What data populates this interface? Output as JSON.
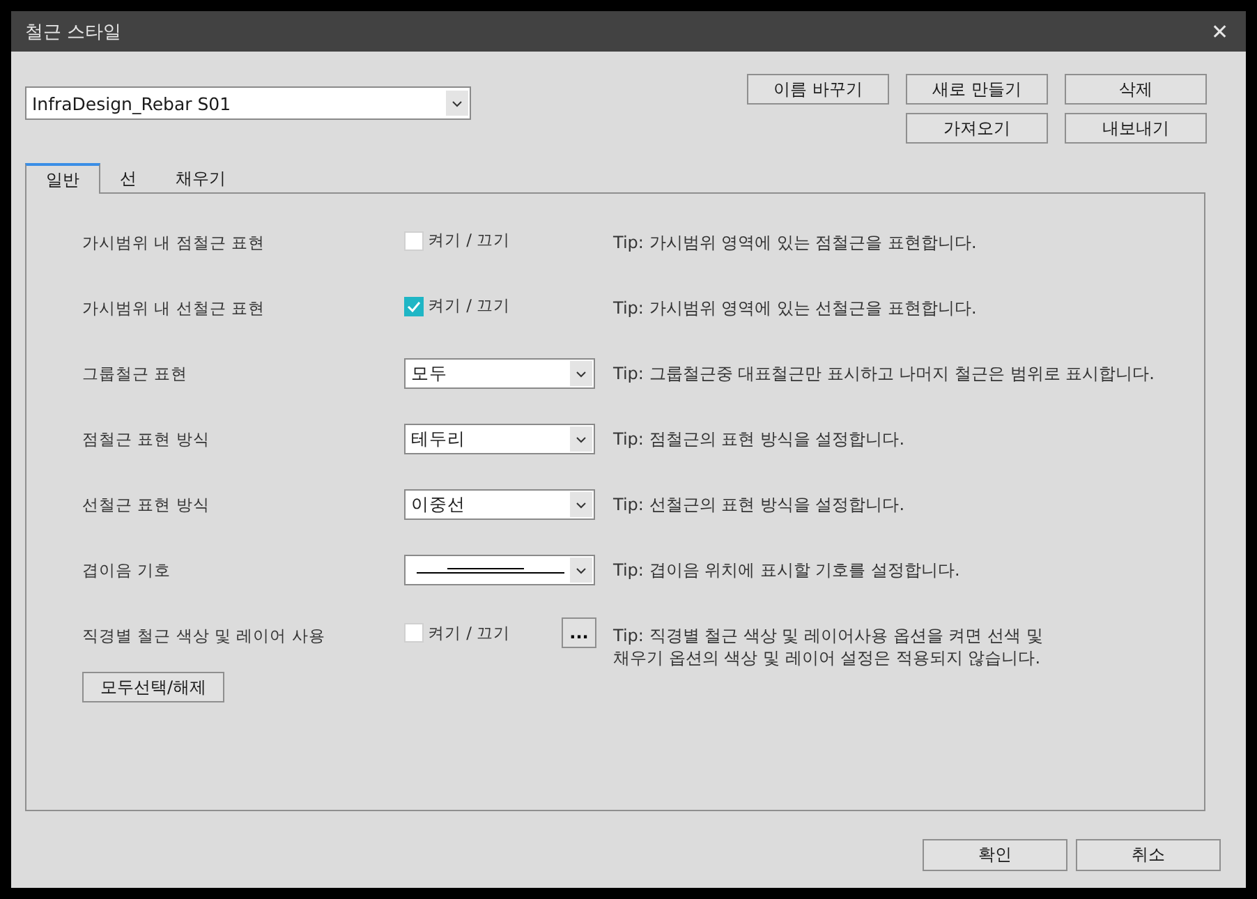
{
  "window": {
    "title": "철근 스타일",
    "close": "✕"
  },
  "style_select": {
    "value": "InfraDesign_Rebar S01"
  },
  "top_buttons": [
    [
      "이름 바꾸기",
      "새로 만들기",
      "삭제"
    ],
    [
      "가져오기",
      "내보내기"
    ]
  ],
  "tabs": [
    {
      "label": "일반",
      "selected": true
    },
    {
      "label": "선",
      "selected": false
    },
    {
      "label": "채우기",
      "selected": false
    }
  ],
  "rows": [
    {
      "kind": "checkbox",
      "label": "가시범위 내 점철근 표현",
      "checked": false,
      "option": "켜기 / 끄기",
      "tip": "Tip: 가시범위 영역에 있는 점철근을 표현합니다."
    },
    {
      "kind": "checkbox",
      "label": "가시범위 내 선철근 표현",
      "checked": true,
      "option": "켜기 / 끄기",
      "tip": "Tip: 가시범위 영역에 있는 선철근을 표현합니다."
    },
    {
      "kind": "select",
      "label": "그룹철근 표현",
      "value": "모두",
      "tip": "Tip: 그룹철근중 대표철근만 표시하고 나머지 철근은 범위로 표시합니다."
    },
    {
      "kind": "select",
      "label": "점철근 표현 방식",
      "value": "테두리",
      "tip": "Tip: 점철근의 표현 방식을 설정합니다."
    },
    {
      "kind": "select",
      "label": "선철근 표현 방식",
      "value": "이중선",
      "tip": "Tip: 선철근의 표현 방식을 설정합니다."
    },
    {
      "kind": "symbol",
      "label": "겹이음 기호",
      "tip": "Tip: 겹이음 위치에 표시할 기호를 설정합니다."
    },
    {
      "kind": "checkbox-more",
      "label": "직경별 철근 색상 및 레이어 사용",
      "checked": false,
      "option": "켜기 / 끄기",
      "more": "...",
      "tip": "Tip: 직경별 철근 색상 및 레이어사용 옵션을 켜면 선색 및\n채우기 옵션의 색상 및 레이어 설정은 적용되지 않습니다."
    }
  ],
  "select_all_button": "모두선택/해제",
  "footer_buttons": [
    "확인",
    "취소"
  ]
}
